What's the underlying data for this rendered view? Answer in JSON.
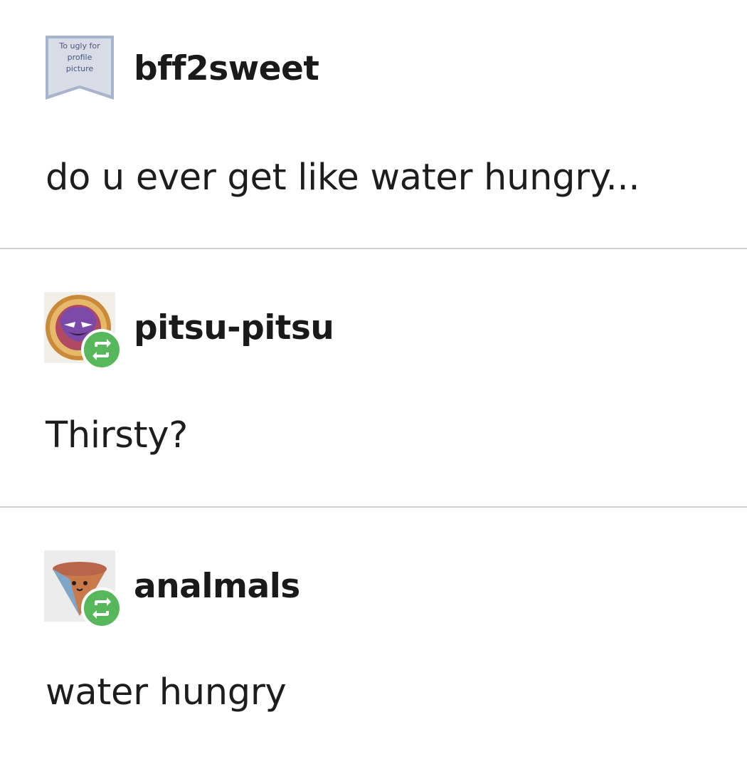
{
  "thread": {
    "posts": [
      {
        "username": "bff2sweet",
        "avatar_text": [
          "To ugly for",
          "profile",
          "picture"
        ],
        "avatar_icon": "ribbon-placeholder-avatar",
        "reblog": false,
        "text": "do u ever get like water hungry..."
      },
      {
        "username": "pitsu-pitsu",
        "avatar_icon": "purple-creature-medallion-avatar",
        "reblog": true,
        "reblog_icon": "reblog-icon",
        "text": "Thirsty?"
      },
      {
        "username": "analmals",
        "avatar_icon": "ice-cream-cone-avatar",
        "reblog": true,
        "reblog_icon": "reblog-icon",
        "text": "water hungry"
      }
    ]
  },
  "colors": {
    "reblog_green": "#56b85a",
    "divider": "#cfcfcf",
    "text": "#1b1b1b"
  }
}
